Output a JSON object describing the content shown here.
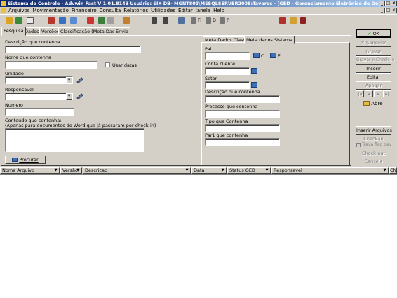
{
  "window": {
    "title": "Sistema de Controle - Advwin Fast     V 1.01.8143     Usuário: SIX     DB- MGNT801\\MSSQLSERVER2008:Tavares - [GED - Gerenciamento Eletrônico de Do]"
  },
  "menu": [
    "Arquivos",
    "Movimentação",
    "Financeiro",
    "Consulta",
    "Relatórios",
    "Utilidades",
    "Editar",
    "Janela",
    "Help"
  ],
  "toolbar_icons": {
    "fi": "Fi",
    "d": "D",
    "p": "P"
  },
  "tabs": [
    "Pesquisa",
    "Dados",
    "Versões",
    "Classificação (Meta Dados)",
    "Envio"
  ],
  "search": {
    "descricao_label": "Descrição que contenha",
    "descricao_value": "",
    "nome_label": "Nome que contenha",
    "nome_value": "",
    "usar_datas_label": "Usar datas",
    "unidade_label": "Unidade",
    "responsavel_label": "Responsavel",
    "numero_label": "Numero",
    "conteudo_label": "Conteúdo que contenha:",
    "conteudo_note": "(Apenas para documentos do Word que já passaram por check-in)",
    "procurar_label": "Procurar"
  },
  "meta_tabs": [
    "Meta Dados Classif.",
    "Meta dados Sistema"
  ],
  "meta": {
    "pai_label": "Pai",
    "c_label": "C",
    "f_label": "F",
    "conta_cliente_label": "Conta cliente",
    "setor_label": "Setor",
    "descricao_label": "Descrição que contenha",
    "processo_label": "Processo que contenha",
    "tipo_label": "Tipo que Contenha",
    "par1_label": "Par1 que contenha"
  },
  "side_buttons": {
    "ok": "OK",
    "cancelar": "Cancelar",
    "gravar": "Gravar",
    "gravar_checkin": "Gravar e Check-in",
    "inserir": "Inserir",
    "editar": "Editar",
    "apagar": "Apagar",
    "abre": "Abre",
    "inserir_arquivos": "Inserir Arquivos",
    "check_in": "Check-in",
    "trava_flag": "Trava flag dev",
    "check_out": "Check-out",
    "cancela": "Cancela"
  },
  "grid_columns": [
    "Nome Arquivo",
    "Versão",
    "Descricao",
    "Data",
    "Status GED",
    "Responsavel",
    "Ch"
  ],
  "colors": {
    "title_start": "#0a246a",
    "title_end": "#a6caf0",
    "face": "#d4d0c8",
    "ok_green": "#2a9a2a"
  }
}
